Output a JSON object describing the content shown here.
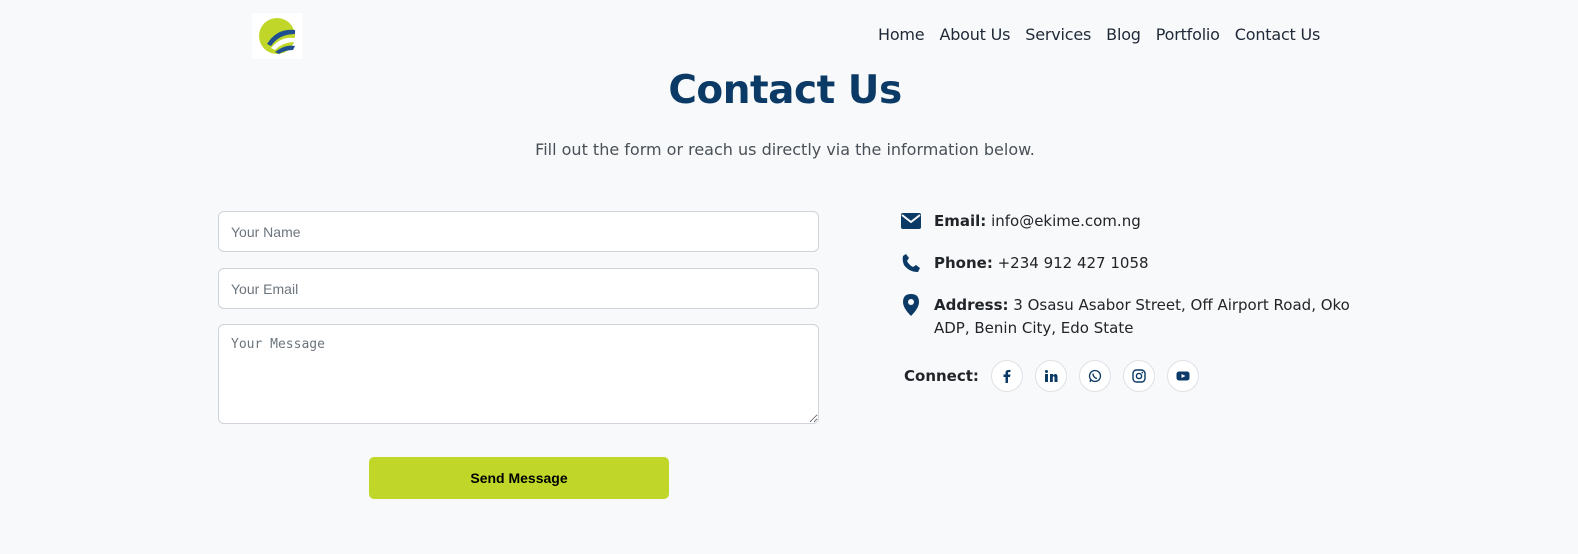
{
  "nav": {
    "items": [
      "Home",
      "About Us",
      "Services",
      "Blog",
      "Portfolio",
      "Contact Us"
    ]
  },
  "hero": {
    "title": "Contact Us",
    "subtitle": "Fill out the form or reach us directly via the information below."
  },
  "form": {
    "name_placeholder": "Your Name",
    "email_placeholder": "Your Email",
    "message_placeholder": "Your Message",
    "submit_label": "Send Message"
  },
  "contact": {
    "email_label": "Email:",
    "email_value": "info@ekime.com.ng",
    "phone_label": "Phone:",
    "phone_value": "+234 912 427 1058",
    "address_label": "Address:",
    "address_value": "3 Osasu Asabor Street, Off Airport Road, Oko ADP, Benin City, Edo State",
    "connect_label": "Connect:"
  },
  "icons": {
    "email": "envelope-icon",
    "phone": "phone-icon",
    "address": "map-marker-icon",
    "social": [
      "facebook-icon",
      "linkedin-icon",
      "whatsapp-icon",
      "instagram-icon",
      "youtube-icon"
    ]
  },
  "colors": {
    "primary": "#0b3a66",
    "accent": "#c0d72a",
    "background": "#f8f9fa"
  }
}
